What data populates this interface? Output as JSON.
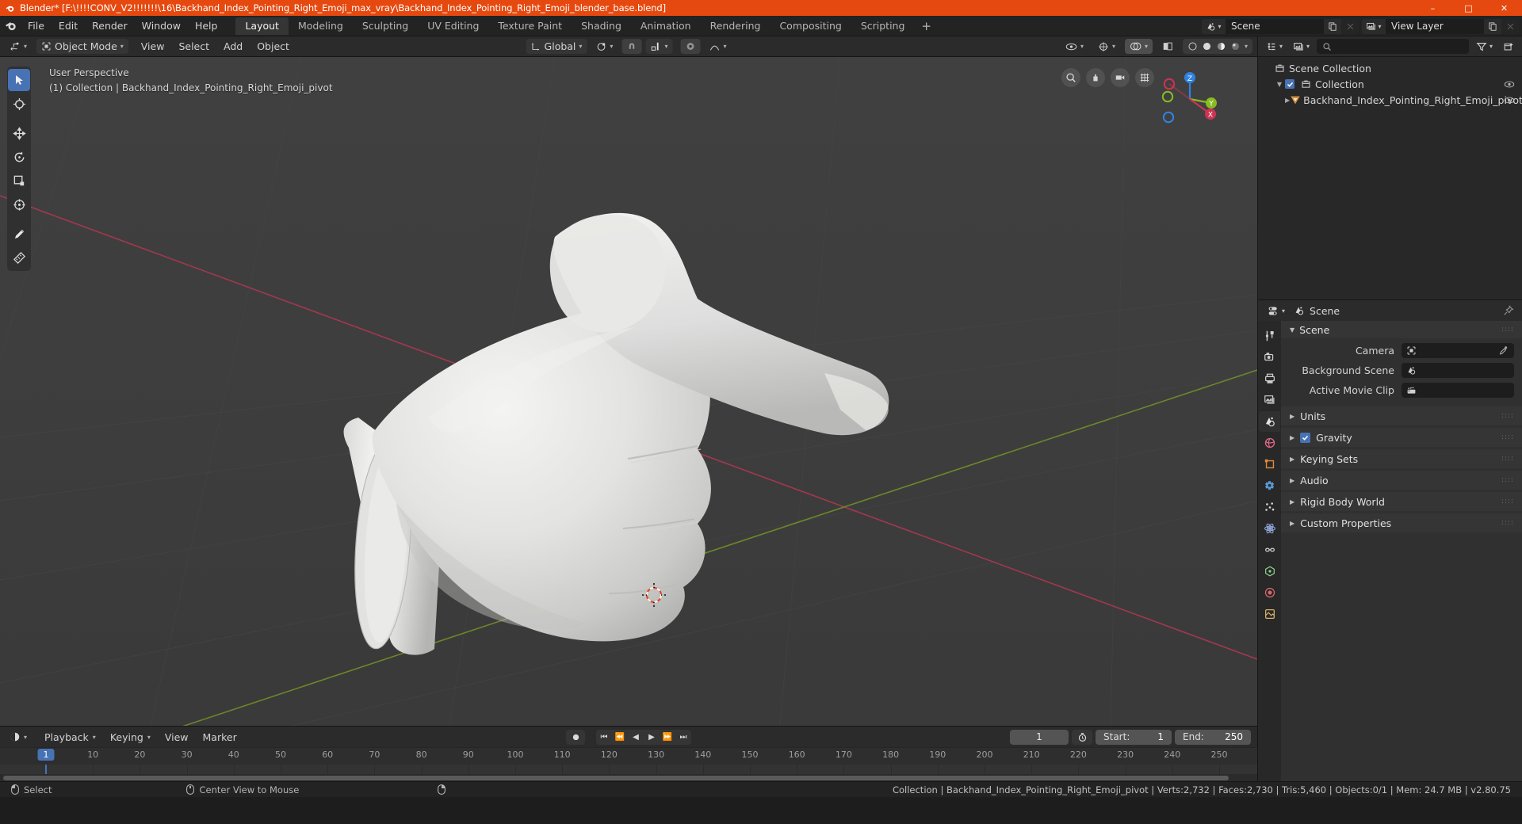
{
  "window": {
    "title": "Blender* [F:\\!!!!CONV_V2!!!!!!!\\16\\Backhand_Index_Pointing_Right_Emoji_max_vray\\Backhand_Index_Pointing_Right_Emoji_blender_base.blend]",
    "minimize": "–",
    "maximize": "□",
    "close": "✕"
  },
  "topbar": {
    "menus": [
      "File",
      "Edit",
      "Render",
      "Window",
      "Help"
    ],
    "workspaces": [
      {
        "label": "Layout",
        "active": true
      },
      {
        "label": "Modeling",
        "active": false
      },
      {
        "label": "Sculpting",
        "active": false
      },
      {
        "label": "UV Editing",
        "active": false
      },
      {
        "label": "Texture Paint",
        "active": false
      },
      {
        "label": "Shading",
        "active": false
      },
      {
        "label": "Animation",
        "active": false
      },
      {
        "label": "Rendering",
        "active": false
      },
      {
        "label": "Compositing",
        "active": false
      },
      {
        "label": "Scripting",
        "active": false
      }
    ],
    "add_workspace": "+",
    "scene_name": "Scene",
    "view_layer_name": "View Layer"
  },
  "viewport": {
    "mode": "Object Mode",
    "menus": [
      "View",
      "Select",
      "Add",
      "Object"
    ],
    "transform_orientation": "Global",
    "info_line1": "User Perspective",
    "info_line2": "(1) Collection | Backhand_Index_Pointing_Right_Emoji_pivot",
    "gizmo_axes": {
      "x": "X",
      "y": "Y",
      "z": "Z"
    },
    "tools": [
      {
        "name": "tweak-select-tool",
        "active": true
      },
      {
        "name": "cursor-tool",
        "active": false
      },
      {
        "name": "move-tool",
        "active": false
      },
      {
        "name": "rotate-tool",
        "active": false
      },
      {
        "name": "scale-tool",
        "active": false
      },
      {
        "name": "transform-tool",
        "active": false
      },
      {
        "name": "annotate-tool",
        "active": false
      },
      {
        "name": "measure-tool",
        "active": false
      }
    ]
  },
  "timeline": {
    "editor_label": "",
    "menus": [
      "Playback",
      "Keying",
      "View",
      "Marker"
    ],
    "current_frame": "1",
    "start_label": "Start:",
    "start_value": "1",
    "end_label": "End:",
    "end_value": "250",
    "ruler_ticks": [
      "10",
      "20",
      "30",
      "40",
      "50",
      "60",
      "70",
      "80",
      "90",
      "100",
      "110",
      "120",
      "130",
      "140",
      "150",
      "160",
      "170",
      "180",
      "190",
      "200",
      "210",
      "220",
      "230",
      "240",
      "250"
    ],
    "playhead_label": "1"
  },
  "outliner": {
    "search_placeholder": "",
    "rows": [
      {
        "label": "Scene Collection",
        "indent": 0,
        "icon": "collection-icon",
        "has_disclosure": false,
        "has_checkbox": false,
        "eye": false
      },
      {
        "label": "Collection",
        "indent": 1,
        "icon": "collection-icon",
        "has_disclosure": true,
        "has_checkbox": true,
        "eye": true
      },
      {
        "label": "Backhand_Index_Pointing_Right_Emoji_pivot",
        "indent": 2,
        "icon": "mesh-object-icon",
        "has_disclosure": true,
        "has_checkbox": false,
        "eye": true
      }
    ]
  },
  "properties": {
    "breadcrumb": "Scene",
    "panel_title": "Scene",
    "rows": [
      {
        "label": "Camera",
        "value": "",
        "icon": "camera-icon",
        "eyedropper": true
      },
      {
        "label": "Background Scene",
        "value": "",
        "icon": "scene-icon",
        "eyedropper": false
      },
      {
        "label": "Active Movie Clip",
        "value": "",
        "icon": "clip-icon",
        "eyedropper": false
      }
    ],
    "sections": [
      {
        "label": "Units",
        "checkbox": false
      },
      {
        "label": "Gravity",
        "checkbox": true
      },
      {
        "label": "Keying Sets",
        "checkbox": false
      },
      {
        "label": "Audio",
        "checkbox": false
      },
      {
        "label": "Rigid Body World",
        "checkbox": false
      },
      {
        "label": "Custom Properties",
        "checkbox": false
      }
    ],
    "tabs": [
      {
        "name": "tool-tab",
        "color": "#c8c8c8",
        "active": false
      },
      {
        "name": "render-tab",
        "color": "#c8c8c8",
        "active": false
      },
      {
        "name": "output-tab",
        "color": "#c8c8c8",
        "active": false
      },
      {
        "name": "view-layer-tab",
        "color": "#c8c8c8",
        "active": false
      },
      {
        "name": "scene-tab",
        "color": "#e0e0e0",
        "active": true
      },
      {
        "name": "world-tab",
        "color": "#e06a8a",
        "active": false
      },
      {
        "name": "object-tab",
        "color": "#e2883c",
        "active": false
      },
      {
        "name": "modifier-tab",
        "color": "#5a9bd8",
        "active": false
      },
      {
        "name": "particles-tab",
        "color": "#c8c8c8",
        "active": false
      },
      {
        "name": "physics-tab",
        "color": "#8fa6d8",
        "active": false
      },
      {
        "name": "constraint-tab",
        "color": "#c8c8c8",
        "active": false
      },
      {
        "name": "data-tab",
        "color": "#8ed08a",
        "active": false
      },
      {
        "name": "material-tab",
        "color": "#d86a6a",
        "active": false
      },
      {
        "name": "texture-tab",
        "color": "#d8b26a",
        "active": false
      }
    ]
  },
  "statusbar": {
    "hint_select": "Select",
    "hint_center_view": "Center View to Mouse",
    "stats": "Collection | Backhand_Index_Pointing_Right_Emoji_pivot | Verts:2,732 | Faces:2,730 | Tris:5,460 | Objects:0/1 | Mem: 24.7 MB | v2.80.75"
  },
  "colors": {
    "accent": "#4772b3",
    "title_bar": "#e6490f",
    "viewport_bg": "#3c3c3c",
    "x_axis": "#cc3355",
    "y_axis": "#88bb22",
    "z_axis": "#2f83e3"
  }
}
